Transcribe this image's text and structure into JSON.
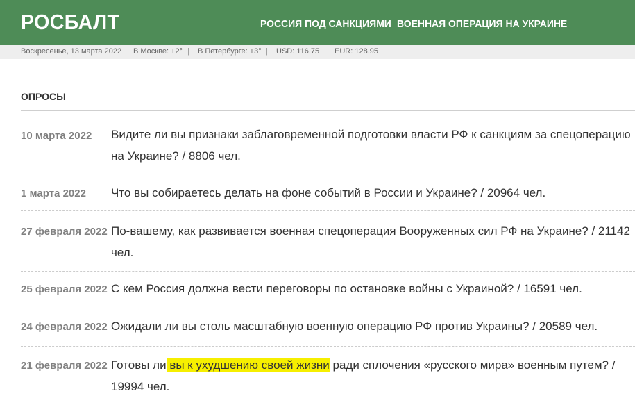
{
  "header": {
    "logo": "РОСБАЛТ",
    "nav": [
      "РОССИЯ ПОД САНКЦИЯМИ",
      "ВОЕННАЯ ОПЕРАЦИЯ НА УКРАИНЕ"
    ]
  },
  "infobar": {
    "date": "Воскресенье, 13 марта 2022",
    "separator": "|",
    "moscow": "В Москве: +2°",
    "petersburg": "В Петербурге: +3°",
    "usd": "USD: 116.75",
    "eur": "EUR: 128.95"
  },
  "section": {
    "title": "ОПРОСЫ"
  },
  "polls": [
    {
      "date": "10 марта 2022",
      "lines": [
        "Видите ли вы признаки заблаговременной подготовки власти РФ к санкциям за спецоперацию",
        "на Украине? / 8806 чел."
      ]
    },
    {
      "date": "1 марта 2022",
      "lines": [
        "Что вы собираетесь делать на фоне событий в России и Украине? / 20964 чел."
      ]
    },
    {
      "date": "27 февраля 2022",
      "lines": [
        "По-вашему, как развивается военная спецоперация Вооруженных сил РФ на Украине? / 21142",
        "чел."
      ]
    },
    {
      "date": "25 февраля 2022",
      "lines": [
        "С кем Россия должна вести переговоры по остановке войны с Украиной? / 16591 чел."
      ]
    },
    {
      "date": "24 февраля 2022",
      "lines": [
        "Ожидали ли вы столь масштабную военную операцию РФ против Украины? / 20589 чел."
      ]
    },
    {
      "date": "21 февраля 2022",
      "line1_before": "Готовы ли",
      "line1_highlight": " вы к ухудшению своей жизни",
      "line1_after": " ради сплочения «русского мира» военным путем? /",
      "line2": "19994 чел."
    }
  ]
}
